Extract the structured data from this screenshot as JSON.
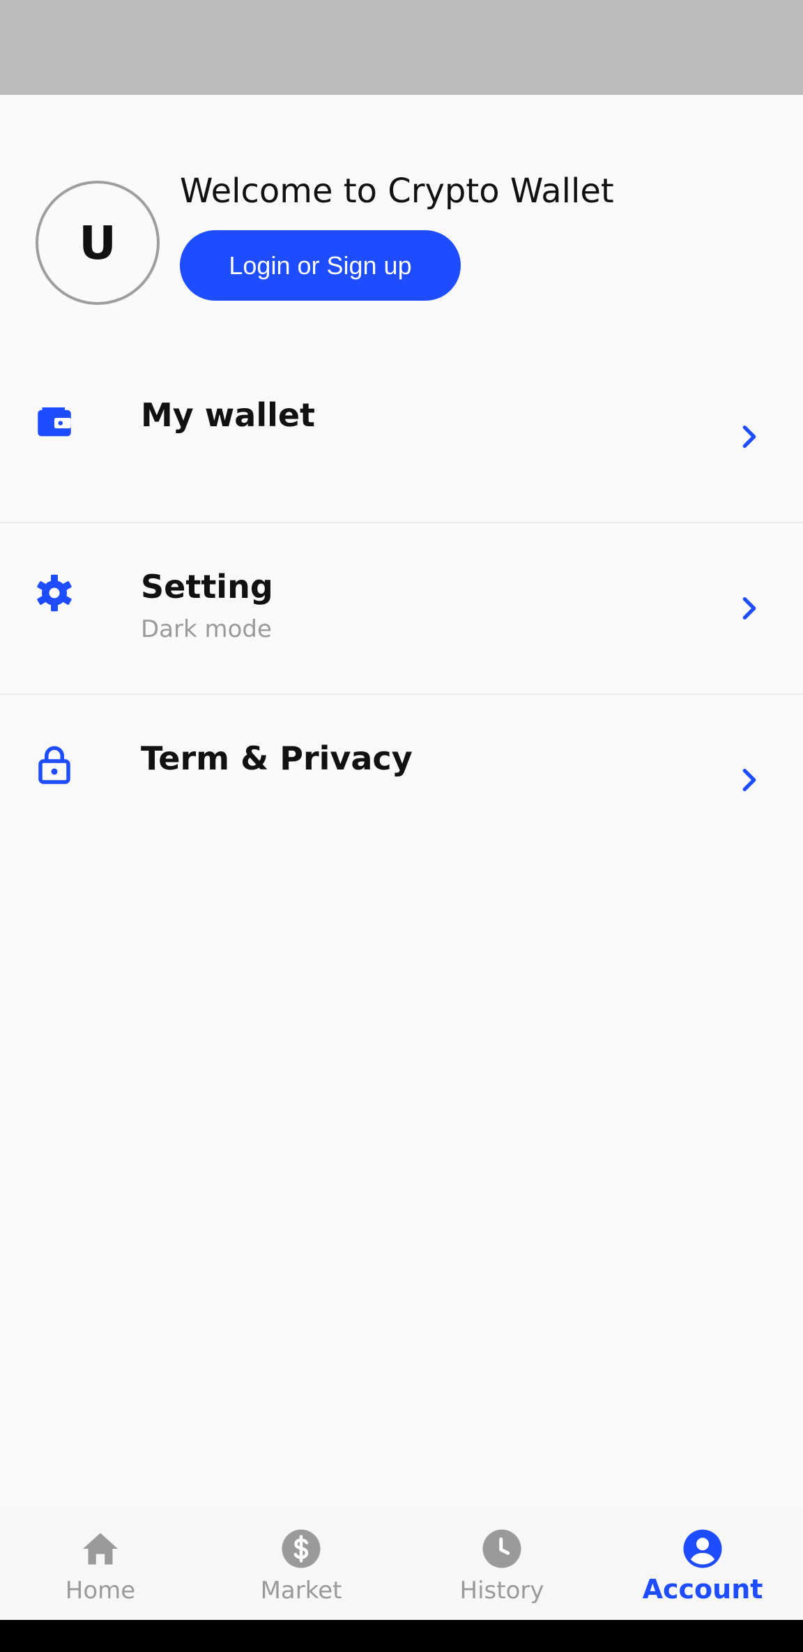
{
  "profile": {
    "avatar_initial": "U",
    "welcome_text": "Welcome to Crypto Wallet",
    "login_label": "Login or Sign up"
  },
  "menu": {
    "items": [
      {
        "title": "My wallet",
        "subtitle": "",
        "icon": "wallet-icon"
      },
      {
        "title": "Setting",
        "subtitle": "Dark mode",
        "icon": "gear-icon"
      },
      {
        "title": "Term & Privacy",
        "subtitle": "",
        "icon": "lock-icon"
      }
    ]
  },
  "bottom_nav": {
    "items": [
      {
        "label": "Home",
        "icon": "home-icon"
      },
      {
        "label": "Market",
        "icon": "dollar-icon"
      },
      {
        "label": "History",
        "icon": "clock-icon"
      },
      {
        "label": "Account",
        "icon": "account-icon",
        "active": true
      }
    ]
  },
  "colors": {
    "accent": "#1e4dff",
    "inactive": "#9a9a9a",
    "background": "#fafafa",
    "status_bar": "#bbbbbb"
  }
}
